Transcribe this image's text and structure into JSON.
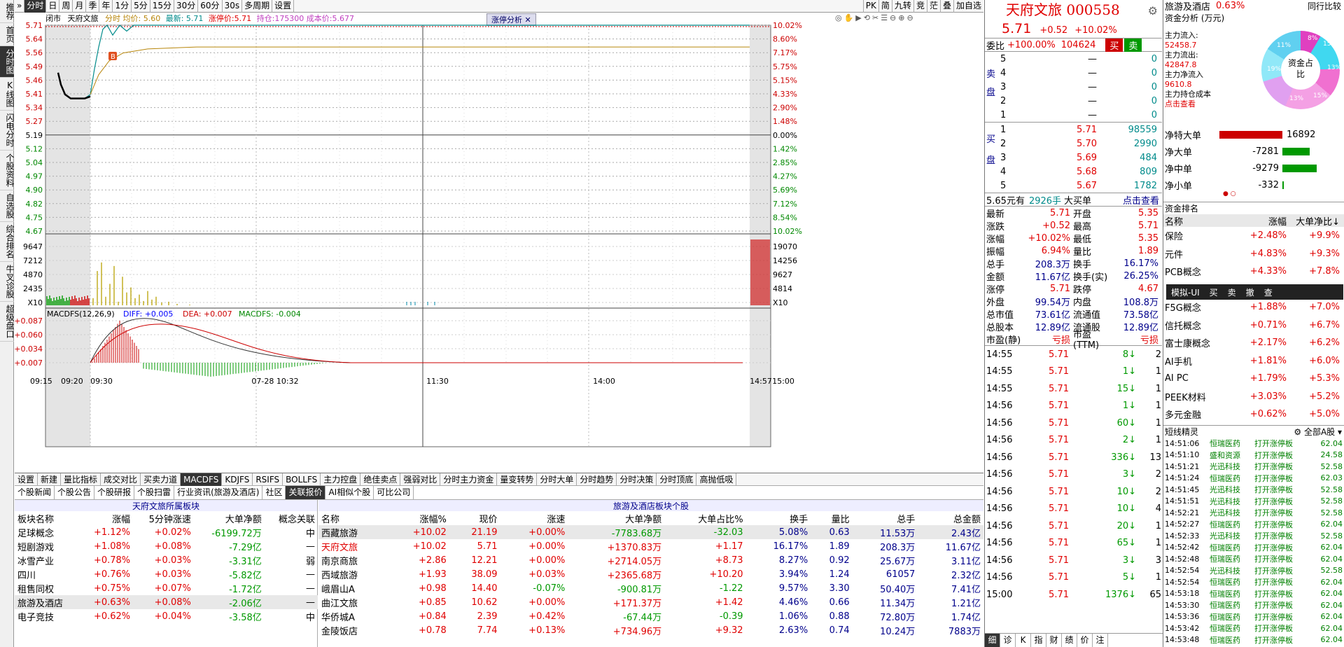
{
  "leftnav": [
    "推荐",
    "首页",
    "分时图",
    "K线图",
    "闪电分时",
    "个股资料",
    "自选股",
    "综合排名",
    "牛叉诊股",
    "超级盘口"
  ],
  "toolbar": {
    "periods": [
      "分时",
      "日",
      "周",
      "月",
      "季",
      "年",
      "1分",
      "5分",
      "15分",
      "30分",
      "60分",
      "30s",
      "多周期",
      "设置"
    ],
    "right": [
      "PK",
      "简",
      "九转",
      "竞",
      "茫",
      "叠",
      "加自选"
    ]
  },
  "chart_header": {
    "status": "闭市",
    "name": "天府文旅",
    "avg_label": "分时",
    "avg": "均价: 5.60",
    "latest": "最新: 5.71",
    "limit": "涨停价:5.71",
    "hold": "持仓:175300 成本价:5.677",
    "analysis": "涨停分析"
  },
  "price_ticks": [
    "5.71",
    "5.64",
    "5.56",
    "5.49",
    "5.46",
    "5.41",
    "5.34",
    "5.27",
    "5.19",
    "5.12",
    "5.04",
    "4.97",
    "4.90",
    "4.82",
    "4.75",
    "4.67"
  ],
  "pct_ticks": [
    "10.02%",
    "8.60%",
    "7.17%",
    "5.75%",
    "5.15%",
    "4.33%",
    "2.90%",
    "1.48%",
    "0.00%",
    "1.42%",
    "2.85%",
    "4.27%",
    "5.69%",
    "7.12%",
    "8.54%",
    "10.02%"
  ],
  "vol_ticks_left": [
    "9647",
    "7212",
    "4870",
    "2435",
    "X10"
  ],
  "vol_ticks_right": [
    "19070",
    "14256",
    "9627",
    "4814",
    "X10"
  ],
  "macd": {
    "label": "MACDFS(12,26,9)",
    "diff": "DIFF: +0.005",
    "dea": "DEA: +0.007",
    "macdfs": "MACDFS: -0.004",
    "ticks": [
      "+0.087",
      "+0.060",
      "+0.034",
      "+0.007"
    ]
  },
  "time_ticks": [
    "09:15",
    "09:20",
    "09:30",
    "07-28 10:32",
    "11:30",
    "14:00",
    "14:57",
    "15:00"
  ],
  "buy_marker": "B",
  "indicator_tabs": [
    "设置",
    "新建",
    "量比指标",
    "成交对比",
    "买卖力道",
    "MACDFS",
    "KDJFS",
    "RSIFS",
    "BOLLFS",
    "主力控盘",
    "绝佳卖点",
    "强弱对比",
    "分时主力资金",
    "量变转势",
    "分时大单",
    "分时趋势",
    "分时决策",
    "分时顶底",
    "高抛低吸"
  ],
  "news_tabs": [
    "个股新闻",
    "个股公告",
    "个股研报",
    "个股扫雷",
    "行业资讯(旅游及酒店)",
    "社区",
    "关联报价",
    "AI相似个股",
    "可比公司"
  ],
  "sector_panel": {
    "title": "天府文旅所属板块",
    "headers": [
      "板块名称",
      "涨幅",
      "5分钟涨速",
      "大单净额",
      "概念关联"
    ],
    "rows": [
      [
        "足球概念",
        "+1.12%",
        "+0.02%",
        "-6199.72万",
        "中"
      ],
      [
        "短剧游戏",
        "+1.08%",
        "+0.08%",
        "-7.29亿",
        "—"
      ],
      [
        "冰雪产业",
        "+0.78%",
        "+0.03%",
        "-3.31亿",
        "弱"
      ],
      [
        "四川",
        "+0.76%",
        "+0.03%",
        "-5.82亿",
        "—"
      ],
      [
        "租售同权",
        "+0.75%",
        "+0.07%",
        "-1.72亿",
        "—"
      ],
      [
        "旅游及酒店",
        "+0.63%",
        "+0.08%",
        "-2.06亿",
        "—"
      ],
      [
        "电子竞技",
        "+0.62%",
        "+0.04%",
        "-3.58亿",
        "中"
      ]
    ]
  },
  "stock_panel": {
    "title": "旅游及酒店板块个股",
    "headers": [
      "名称",
      "涨幅%",
      "现价",
      "涨速",
      "大单净额",
      "大单占比%",
      "换手",
      "量比",
      "总手",
      "总金额"
    ],
    "rows": [
      [
        "西藏旅游",
        "+10.02",
        "21.19",
        "+0.00%",
        "-7783.68万",
        "-32.03",
        "5.08%",
        "0.63",
        "11.53万",
        "2.43亿"
      ],
      [
        "天府文旅",
        "+10.02",
        "5.71",
        "+0.00%",
        "+1370.83万",
        "+1.17",
        "16.17%",
        "1.89",
        "208.3万",
        "11.67亿"
      ],
      [
        "南京商旅",
        "+2.86",
        "12.21",
        "+0.00%",
        "+2714.05万",
        "+8.73",
        "8.27%",
        "0.92",
        "25.67万",
        "3.11亿"
      ],
      [
        "西域旅游",
        "+1.93",
        "38.09",
        "+0.03%",
        "+2365.68万",
        "+10.20",
        "3.94%",
        "1.24",
        "61057",
        "2.32亿"
      ],
      [
        "峨眉山A",
        "+0.98",
        "14.40",
        "-0.07%",
        "-900.81万",
        "-1.22",
        "9.57%",
        "3.30",
        "50.40万",
        "7.41亿"
      ],
      [
        "曲江文旅",
        "+0.85",
        "10.62",
        "+0.00%",
        "+171.37万",
        "+1.42",
        "4.46%",
        "0.66",
        "11.34万",
        "1.21亿"
      ],
      [
        "华侨城A",
        "+0.84",
        "2.39",
        "+0.42%",
        "-67.44万",
        "-0.39",
        "1.06%",
        "0.88",
        "72.80万",
        "1.74亿"
      ],
      [
        "金陵饭店",
        "+0.78",
        "7.74",
        "+0.13%",
        "+734.96万",
        "+9.32",
        "2.63%",
        "0.74",
        "10.24万",
        "7883万"
      ]
    ]
  },
  "quote": {
    "name": "天府文旅",
    "code": "000558",
    "price": "5.71",
    "chg": "+0.52",
    "pct": "+10.02%",
    "weibi_label": "委比",
    "weibi": "+100.00%",
    "weicha": "104624",
    "buy_btn": "买",
    "sell_btn": "卖",
    "sell": [
      [
        "5",
        "—",
        "0"
      ],
      [
        "4",
        "—",
        "0"
      ],
      [
        "3",
        "—",
        "0"
      ],
      [
        "2",
        "—",
        "0"
      ],
      [
        "1",
        "—",
        "0"
      ]
    ],
    "buy": [
      [
        "1",
        "5.71",
        "98559"
      ],
      [
        "2",
        "5.70",
        "2990"
      ],
      [
        "3",
        "5.69",
        "484"
      ],
      [
        "4",
        "5.68",
        "809"
      ],
      [
        "5",
        "5.67",
        "1782"
      ]
    ],
    "sell_side": "卖盘",
    "buy_side": "买盘",
    "bigline": {
      "amount": "5.65元有",
      "hands": "2926手",
      "label": "大买单",
      "link": "点击查看"
    },
    "stats": [
      [
        "最新",
        "5.71",
        "开盘",
        "5.35"
      ],
      [
        "涨跌",
        "+0.52",
        "最高",
        "5.71"
      ],
      [
        "涨幅",
        "+10.02%",
        "最低",
        "5.35"
      ],
      [
        "振幅",
        "6.94%",
        "量比",
        "1.89"
      ],
      [
        "总手",
        "208.3万",
        "换手",
        "16.17%"
      ],
      [
        "金额",
        "11.67亿",
        "换手(实)",
        "26.25%"
      ],
      [
        "涨停",
        "5.71",
        "跌停",
        "4.67"
      ],
      [
        "外盘",
        "99.54万",
        "内盘",
        "108.8万"
      ],
      [
        "总市值",
        "73.61亿",
        "流通值",
        "73.58亿"
      ],
      [
        "总股本",
        "12.89亿",
        "流通股",
        "12.89亿"
      ],
      [
        "市盈(静)",
        "亏损",
        "市盈(TTM)",
        "亏损"
      ]
    ],
    "ticks": [
      [
        "14:55",
        "5.71",
        "8",
        "2"
      ],
      [
        "14:55",
        "5.71",
        "1",
        "1"
      ],
      [
        "14:55",
        "5.71",
        "15",
        "1"
      ],
      [
        "14:56",
        "5.71",
        "1",
        "1"
      ],
      [
        "14:56",
        "5.71",
        "60",
        "1"
      ],
      [
        "14:56",
        "5.71",
        "2",
        "1"
      ],
      [
        "14:56",
        "5.71",
        "336",
        "13"
      ],
      [
        "14:56",
        "5.71",
        "3",
        "2"
      ],
      [
        "14:56",
        "5.71",
        "10",
        "2"
      ],
      [
        "14:56",
        "5.71",
        "10",
        "4"
      ],
      [
        "14:56",
        "5.71",
        "20",
        "1"
      ],
      [
        "14:56",
        "5.71",
        "65",
        "1"
      ],
      [
        "14:56",
        "5.71",
        "3",
        "3"
      ],
      [
        "14:56",
        "5.71",
        "5",
        "1"
      ],
      [
        "15:00",
        "5.71",
        "1376",
        "65"
      ]
    ],
    "bottom_tabs": [
      "细",
      "诊",
      "K",
      "指",
      "财",
      "绩",
      "价",
      "注"
    ]
  },
  "right": {
    "sector": "旅游及酒店",
    "sector_pct": "0.63%",
    "compare": "同行比较",
    "fund_title": "资金分析 (万元)",
    "fund": [
      [
        "主力流入:",
        "52458.7"
      ],
      [
        "主力流出:",
        "42847.8"
      ],
      [
        "主力净流入",
        "9610.8"
      ],
      [
        "主力持仓成本",
        ""
      ]
    ],
    "fund_link": "点击查看",
    "pie_label": "资金占比",
    "pie_pcts": [
      "8%",
      "15%",
      "11%",
      "19%",
      "13%",
      "13%",
      "15%"
    ],
    "net": [
      [
        "净特大单",
        "16892"
      ],
      [
        "净大单",
        "-7281"
      ],
      [
        "净中单",
        "-9279"
      ],
      [
        "净小单",
        "-332"
      ]
    ],
    "rank_title": "资金排名",
    "rank_headers": [
      "名称",
      "涨幅",
      "大单净比"
    ],
    "rank": [
      [
        "保险",
        "+2.48%",
        "+9.9%"
      ],
      [
        "元件",
        "+4.83%",
        "+9.3%"
      ],
      [
        "PCB概念",
        "+4.33%",
        "+7.8%"
      ],
      [
        "",
        "",
        ""
      ],
      [
        "F5G概念",
        "+1.88%",
        "+7.0%"
      ],
      [
        "信托概念",
        "+0.71%",
        "+6.7%"
      ],
      [
        "富士康概念",
        "+2.17%",
        "+6.2%"
      ],
      [
        "AI手机",
        "+1.81%",
        "+6.0%"
      ],
      [
        "AI PC",
        "+1.79%",
        "+5.3%"
      ],
      [
        "PEEK材料",
        "+3.03%",
        "+5.2%"
      ],
      [
        "多元金融",
        "+0.62%",
        "+5.0%"
      ]
    ],
    "sim_menu": [
      "模拟-UI",
      "买",
      "卖",
      "撤",
      "查"
    ],
    "short_title": "短线精灵",
    "short_scope": "全部A股",
    "short": [
      [
        "14:51:06",
        "恒瑞医药",
        "打开涨停板",
        "62.04"
      ],
      [
        "14:51:10",
        "盛和资源",
        "打开涨停板",
        "24.58"
      ],
      [
        "14:51:21",
        "光迅科技",
        "打开涨停板",
        "52.58"
      ],
      [
        "14:51:24",
        "恒瑞医药",
        "打开涨停板",
        "62.03"
      ],
      [
        "14:51:45",
        "光迅科技",
        "打开涨停板",
        "52.58"
      ],
      [
        "14:51:51",
        "光迅科技",
        "打开涨停板",
        "52.58"
      ],
      [
        "14:52:21",
        "光迅科技",
        "打开涨停板",
        "52.58"
      ],
      [
        "14:52:27",
        "恒瑞医药",
        "打开涨停板",
        "62.04"
      ],
      [
        "14:52:33",
        "光迅科技",
        "打开涨停板",
        "52.58"
      ],
      [
        "14:52:42",
        "恒瑞医药",
        "打开涨停板",
        "62.04"
      ],
      [
        "14:52:48",
        "恒瑞医药",
        "打开涨停板",
        "62.04"
      ],
      [
        "14:52:54",
        "光迅科技",
        "打开涨停板",
        "52.58"
      ],
      [
        "14:52:54",
        "恒瑞医药",
        "打开涨停板",
        "62.04"
      ],
      [
        "14:53:18",
        "恒瑞医药",
        "打开涨停板",
        "62.04"
      ],
      [
        "14:53:30",
        "恒瑞医药",
        "打开涨停板",
        "62.04"
      ],
      [
        "14:53:36",
        "恒瑞医药",
        "打开涨停板",
        "62.04"
      ],
      [
        "14:53:42",
        "恒瑞医药",
        "打开涨停板",
        "62.04"
      ],
      [
        "14:53:48",
        "恒瑞医药",
        "打开涨停板",
        "62.04"
      ]
    ]
  }
}
